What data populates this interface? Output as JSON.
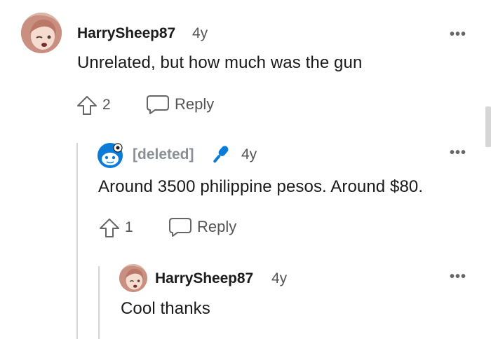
{
  "comments": [
    {
      "username": "HarrySheep87",
      "age": "4y",
      "text": "Unrelated, but how much was the gun",
      "votes": "2",
      "reply_label": "Reply",
      "more": "•••"
    },
    {
      "username": "[deleted]",
      "age": "4y",
      "text": "Around 3500 philippine pesos. Around $80.",
      "votes": "1",
      "reply_label": "Reply",
      "more": "•••"
    },
    {
      "username": "HarrySheep87",
      "age": "4y",
      "text": "Cool thanks",
      "more": "•••"
    }
  ],
  "icons": {
    "upvote": "upvote-arrow-icon",
    "reply": "speech-bubble-icon",
    "more": "more-options-icon",
    "mic": "microphone-icon",
    "snoo": "reddit-snoo-icon"
  },
  "colors": {
    "mic_blue": "#0a7bd6",
    "deleted_grey": "#8a8f96",
    "thread_line": "#d4d6d9"
  }
}
